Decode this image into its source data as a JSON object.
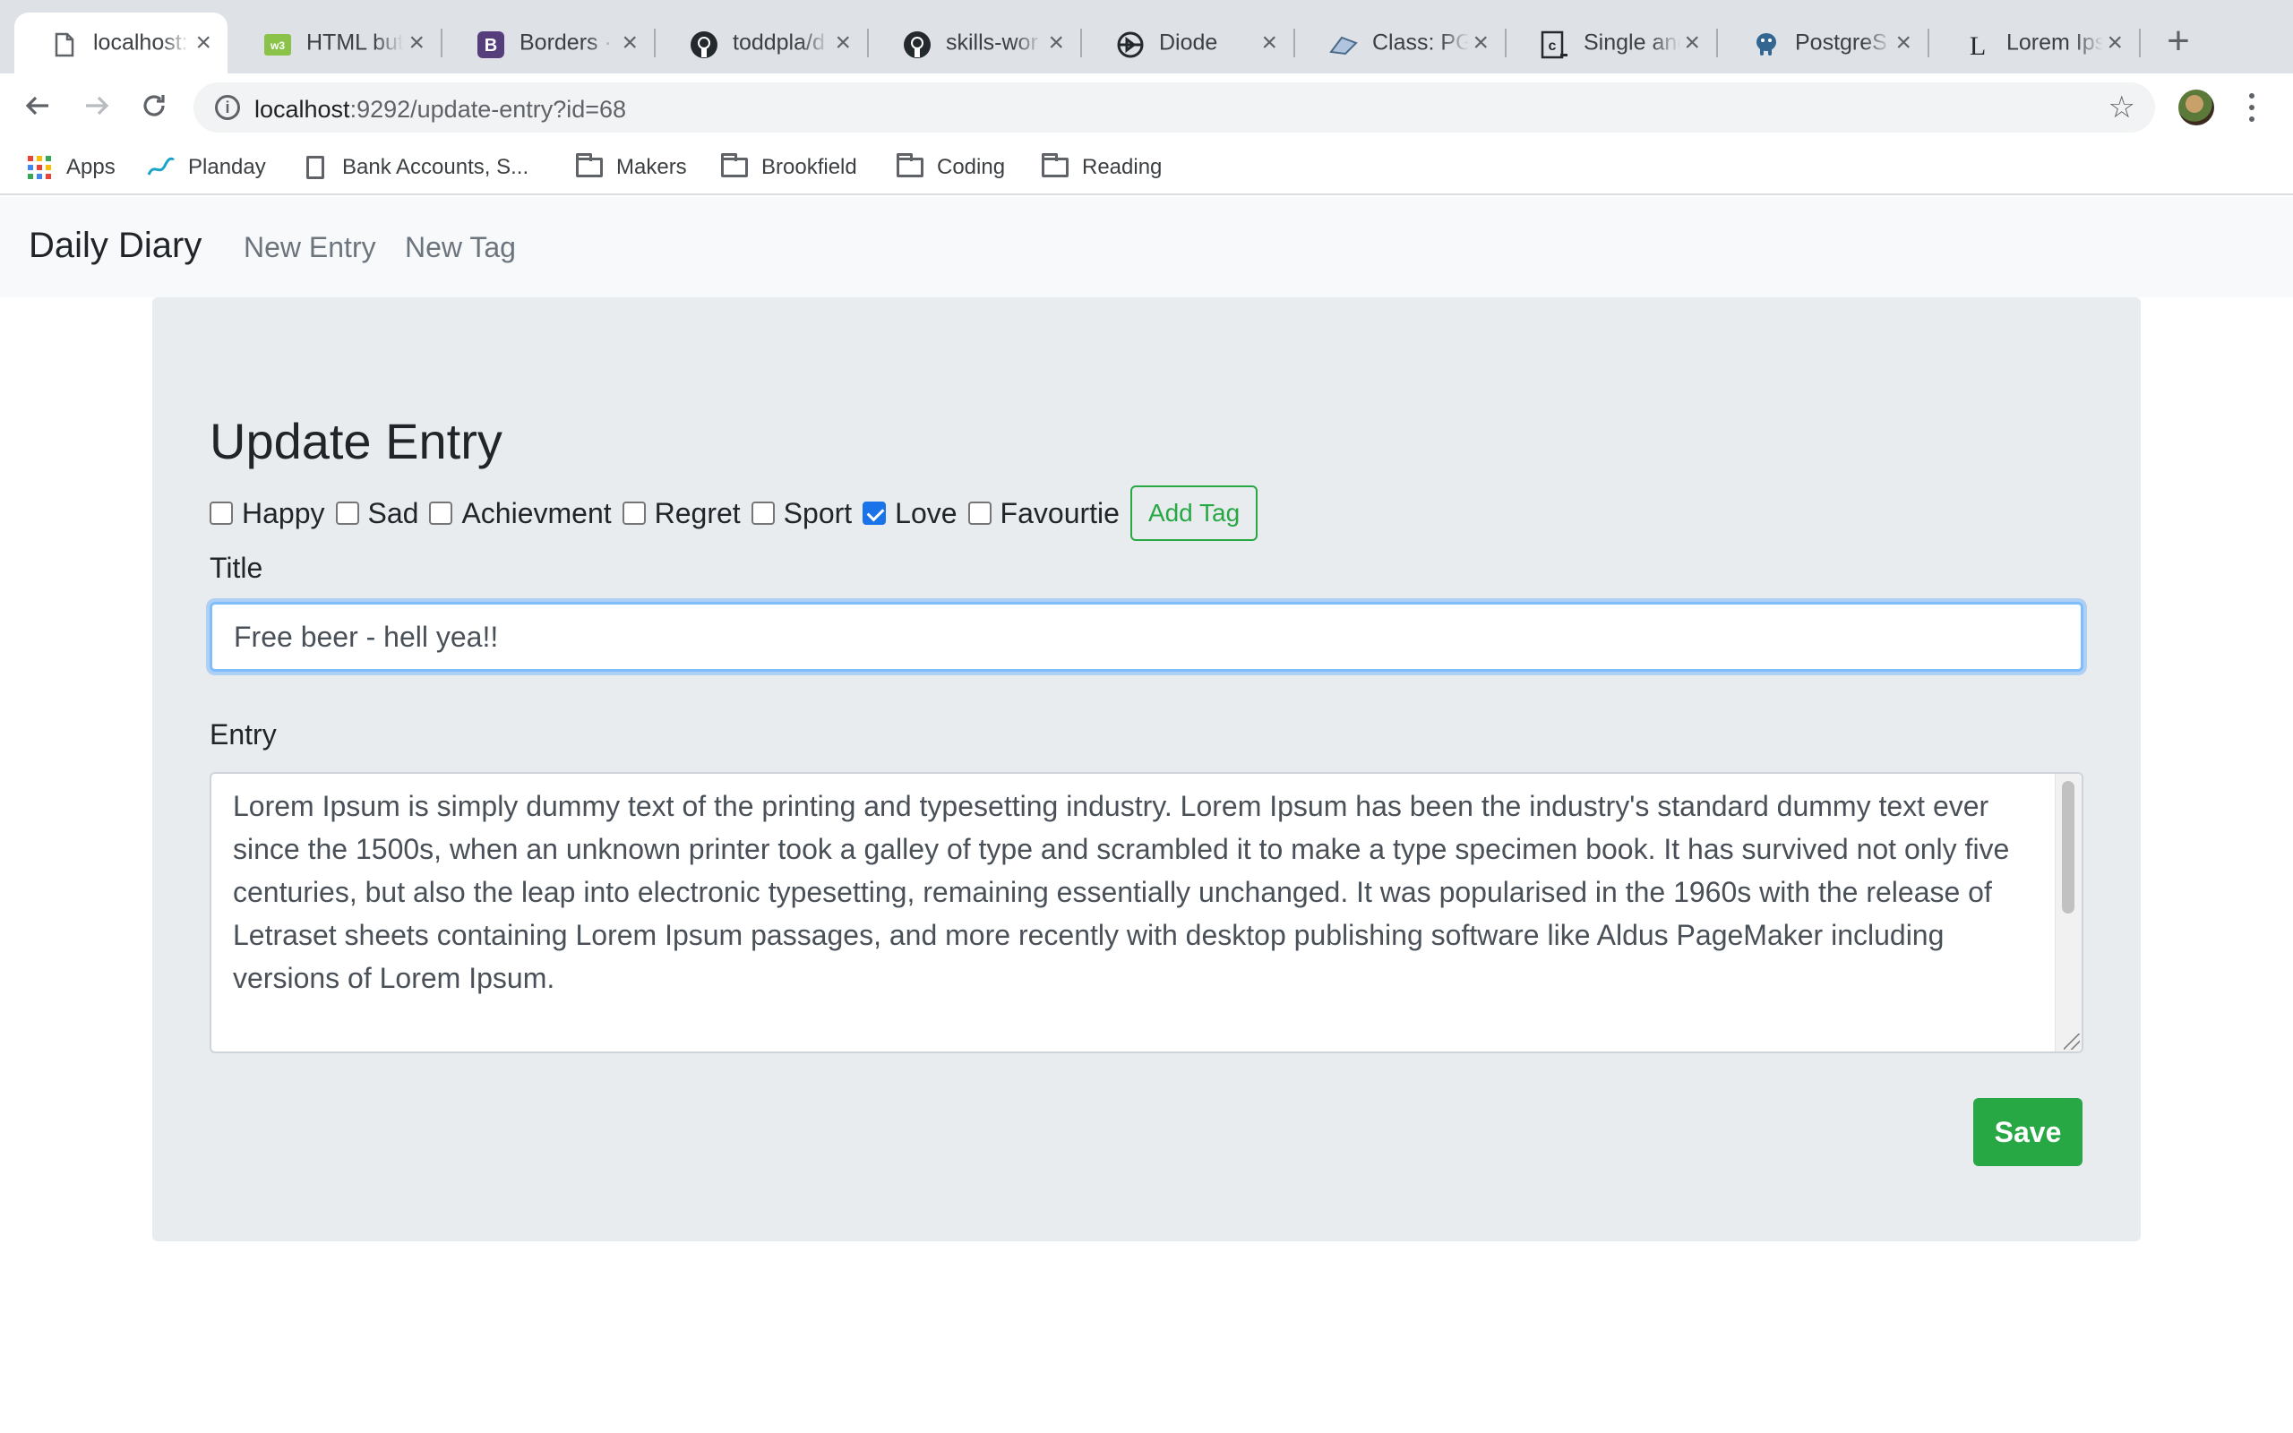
{
  "browser": {
    "tabs": [
      {
        "title": "localhost:",
        "icon": "page-icon"
      },
      {
        "title": "HTML but",
        "icon": "w3schools-icon"
      },
      {
        "title": "Borders ·",
        "icon": "bootstrap-icon"
      },
      {
        "title": "toddpla/d",
        "icon": "github-icon"
      },
      {
        "title": "skills-wor",
        "icon": "github-icon"
      },
      {
        "title": "Diode",
        "icon": "diode-icon"
      },
      {
        "title": "Class: PG",
        "icon": "ruby-doc-icon"
      },
      {
        "title": "Single and",
        "icon": "c-icon"
      },
      {
        "title": "PostgreS",
        "icon": "postgres-icon"
      },
      {
        "title": "Lorem Ips",
        "icon": "lorem-icon"
      }
    ],
    "url_host": "localhost",
    "url_rest": ":9292/update-entry?id=68",
    "bookmarks": [
      {
        "label": "Apps",
        "icon": "apps-icon"
      },
      {
        "label": "Planday",
        "icon": "planday-icon"
      },
      {
        "label": "Bank Accounts, S...",
        "icon": "page-icon"
      },
      {
        "label": "Makers",
        "icon": "folder-icon"
      },
      {
        "label": "Brookfield",
        "icon": "folder-icon"
      },
      {
        "label": "Coding",
        "icon": "folder-icon"
      },
      {
        "label": "Reading",
        "icon": "folder-icon"
      }
    ]
  },
  "app_nav": {
    "brand": "Daily Diary",
    "links": [
      "New Entry",
      "New Tag"
    ]
  },
  "form": {
    "heading": "Update Entry",
    "tags": [
      {
        "label": "Happy",
        "checked": false
      },
      {
        "label": "Sad",
        "checked": false
      },
      {
        "label": "Achievment",
        "checked": false
      },
      {
        "label": "Regret",
        "checked": false
      },
      {
        "label": "Sport",
        "checked": false
      },
      {
        "label": "Love",
        "checked": true
      },
      {
        "label": "Favourtie",
        "checked": false
      }
    ],
    "add_tag_label": "Add Tag",
    "title_label": "Title",
    "title_value": "Free beer - hell yea!!",
    "entry_label": "Entry",
    "entry_value": "Lorem Ipsum is simply dummy text of the printing and typesetting industry. Lorem Ipsum has been the industry's standard dummy text ever since the 1500s, when an unknown printer took a galley of type and scrambled it to make a type specimen book. It has survived not only five centuries, but also the leap into electronic typesetting, remaining essentially unchanged. It was popularised in the 1960s with the release of Letraset sheets containing Lorem Ipsum passages, and more recently with desktop publishing software like Aldus PageMaker including versions of Lorem Ipsum.",
    "save_label": "Save"
  },
  "colors": {
    "success": "#28a745",
    "focus_border": "#80bdff",
    "jumbotron_bg": "#e9ecef",
    "navbar_bg": "#f8f9fa",
    "checkbox_checked": "#1a73e8"
  }
}
